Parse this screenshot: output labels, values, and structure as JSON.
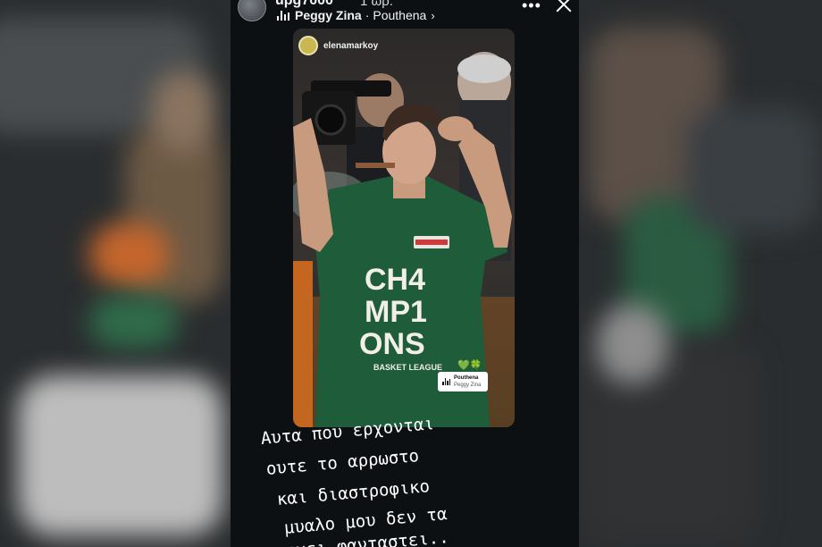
{
  "header": {
    "username": "upg7000",
    "time_ago": "1 ωρ.",
    "song_artist": "Peggy Zina",
    "song_title": "Pouthena",
    "song_separator": "·",
    "chevron": "›",
    "more_icon": "•••",
    "close_icon": "close-icon"
  },
  "post": {
    "username": "elenamarkoy",
    "shirt_lines": [
      "CH4",
      "MP1",
      "ONS"
    ],
    "shirt_small": "BASKET LEAGUE",
    "sponsor": "stoiximan",
    "hearts": "💚🍀"
  },
  "music_sticker": {
    "title": "Pouthena",
    "artist": "Peggy Zina"
  },
  "caption": {
    "lines": [
      "Αυτα που ερχονται",
      "ουτε το αρρωστο",
      "και διαστροφικο",
      "μυαλο μου δεν τα",
      "εχει φανταστει.."
    ]
  },
  "colors": {
    "shirt_green": "#1e5c3a",
    "text_white": "#ffffff"
  }
}
